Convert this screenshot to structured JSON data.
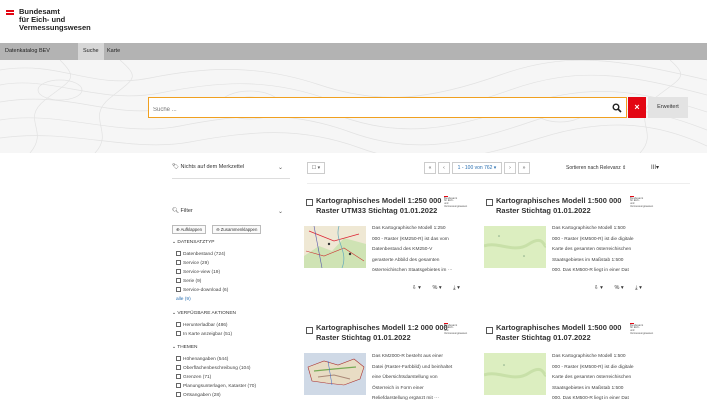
{
  "agency": {
    "lines": [
      "Bundesamt",
      "für Eich- und",
      "Vermessungswesen"
    ]
  },
  "nav": {
    "items": [
      "Datenkatalog BEV",
      "Suche",
      "Karte"
    ],
    "active": "Suche"
  },
  "search": {
    "placeholder": "Suche ...",
    "advanced_label": "Erweitert",
    "clear_icon": "×",
    "search_icon": "search-icon"
  },
  "sidebar": {
    "merkzettel_label": "Nichts auf dem Merkzettel",
    "filter_label": "Filter",
    "expand_label": "Aufklappen",
    "collapse_label": "Zusammenklappen",
    "groups": [
      {
        "title": "DATENSATZTYP",
        "items": [
          {
            "label": "Datenbestand (724)"
          },
          {
            "label": "Service (29)"
          },
          {
            "label": "Service-view (19)"
          },
          {
            "label": "Serie (9)"
          },
          {
            "label": "Service-download (6)"
          }
        ],
        "more": "alle (9)"
      },
      {
        "title": "VERFÜGBARE AKTIONEN",
        "items": [
          {
            "label": "Herunterladbar (486)"
          },
          {
            "label": "In Karte anzeigbar (51)"
          }
        ]
      },
      {
        "title": "THEMEN",
        "items": [
          {
            "label": "Höhenangaben (544)"
          },
          {
            "label": "Oberflächenbeschreibung (104)"
          },
          {
            "label": "Grenzen (71)"
          },
          {
            "label": "Planungsunterlagen, Kataster (70)"
          },
          {
            "label": "Ortsangaben (28)"
          }
        ]
      }
    ]
  },
  "results_toolbar": {
    "select_label": "☐ ▾",
    "first": "«",
    "prev": "‹",
    "range": "1 - 100 von 762 ▾",
    "next": "›",
    "last": "»",
    "sort_label": "Sortieren nach Relevanz",
    "view_icon": "grid-view-icon",
    "view_label": "III▾"
  },
  "logo_mini": {
    "line1": "Bundesamt",
    "line2": "für Eich- und",
    "line3": "Vermessungswesen"
  },
  "cards": [
    {
      "title": "Kartographisches Modell 1:250 000 Raster UTM33 Stichtag 01.01.2022",
      "desc": "Das Kartographische Modell 1:250 000 - Raster (KM250-R) ist das vom Datenbestand des KM250-V gerasterte Abbild des gesamten österreichischen Staatsgebietes im ···",
      "thumb": "map-colored"
    },
    {
      "title": "Kartographisches Modell 1:500 000 Raster Stichtag 01.01.2022",
      "desc": "Das Kartographische Modell 1:500 000 - Raster (KM500-R) ist die digitale Karte des gesamten österreichischen Staatsgebietes im Maßstab 1:500 000. Das KM500-R liegt in einer Dat ···",
      "thumb": "map-green"
    },
    {
      "title": "Kartographisches Modell 1:2 000 000 Raster Stichtag 01.01.2022",
      "desc": "Das KM2000-R besteht aus einer Datei (Raster-Farbbild) und beinhaltet eine Übersichtsdarstellung von Österreich in Form einer Reliefdarstellung ergänzt mit ···",
      "thumb": "map-relief"
    },
    {
      "title": "Kartographisches Modell 1:500 000 Raster Stichtag 01.07.2022",
      "desc": "Das Kartographische Modell 1:500 000 - Raster (KM500-R) ist die digitale Karte des gesamten österreichischen Staatsgebietes im Maßstab 1:500 000. Das KM500-R liegt in einer Dat ···",
      "thumb": "map-green"
    }
  ],
  "card_actions": {
    "download": "⇩ ▾",
    "link": "% ▾",
    "export": "⤓ ▾"
  },
  "colors": {
    "brand_red": "#e30613",
    "nav_bg": "#b3b3b3",
    "nav_active": "#d6d6d6",
    "search_border": "#f0a020",
    "link": "#2a6fb0"
  }
}
